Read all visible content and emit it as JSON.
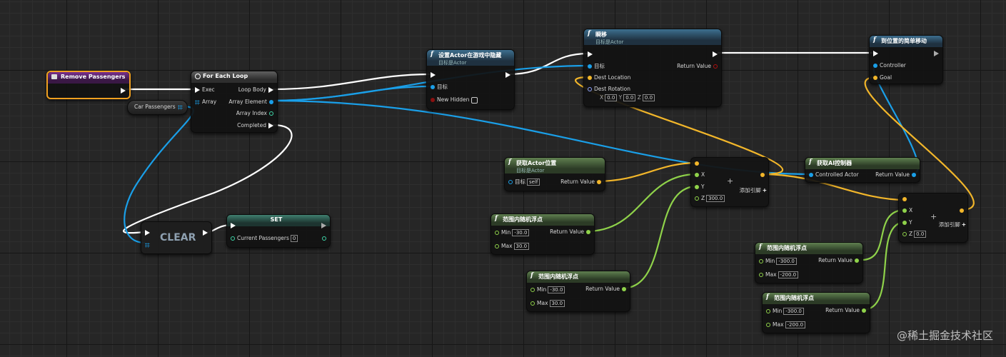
{
  "nodes": {
    "remove_passengers": {
      "title": "Remove Passengers"
    },
    "for_each_loop": {
      "title": "For Each Loop",
      "exec": "Exec",
      "array": "Array",
      "loop_body": "Loop Body",
      "array_element": "Array Element",
      "array_index": "Array Index",
      "completed": "Completed"
    },
    "car_passengers": {
      "label": "Car Passengers"
    },
    "set_hidden": {
      "title": "设置Actor在游戏中隐藏",
      "subtitle": "目标是Actor",
      "target": "目标",
      "new_hidden": "New Hidden"
    },
    "teleport": {
      "title": "瞬移",
      "subtitle": "目标是Actor",
      "target": "目标",
      "dest_location": "Dest Location",
      "return_value": "Return Value",
      "dest_rotation": "Dest Rotation",
      "x": "0.0",
      "y": "0.0",
      "z": "0.0"
    },
    "simple_move": {
      "title": "到位置的简单移动",
      "controller": "Controller",
      "goal": "Goal"
    },
    "get_location": {
      "title": "获取Actor位置",
      "subtitle": "目标是Actor",
      "target": "目标",
      "self": "self",
      "return_value": "Return Value"
    },
    "add1": {
      "x": "X",
      "y": "Y",
      "z": "Z",
      "z_value": "300.0",
      "add_pin": "添加引脚"
    },
    "get_ai": {
      "title": "获取AI控制器",
      "controlled_actor": "Controlled Actor",
      "return_value": "Return Value"
    },
    "add2": {
      "x": "X",
      "y": "Y",
      "z": "Z",
      "z_value": "0.0",
      "add_pin": "添加引脚"
    },
    "clear": {
      "label": "CLEAR"
    },
    "set": {
      "title": "SET",
      "current_passengers": "Current Passengers",
      "value": "0"
    },
    "rand1": {
      "title": "范围内随机浮点",
      "min": "Min",
      "min_value": "-30.0",
      "max": "Max",
      "max_value": "30.0",
      "return_value": "Return Value"
    },
    "rand2": {
      "title": "范围内随机浮点",
      "min": "Min",
      "min_value": "-30.0",
      "max": "Max",
      "max_value": "30.0",
      "return_value": "Return Value"
    },
    "rand3": {
      "title": "范围内随机浮点",
      "min": "Min",
      "min_value": "-300.0",
      "max": "Max",
      "max_value": "-200.0",
      "return_value": "Return Value"
    },
    "rand4": {
      "title": "范围内随机浮点",
      "min": "Min",
      "min_value": "-300.0",
      "max": "Max",
      "max_value": "-200.0",
      "return_value": "Return Value"
    }
  },
  "watermark": "@稀土掘金技术社区",
  "colors": {
    "exec": "#ffffff",
    "object": "#1a9fe8",
    "vector": "#f2b62a",
    "float": "#8fd24a",
    "bool": "#8a1010",
    "integer": "#3ed6a8"
  }
}
